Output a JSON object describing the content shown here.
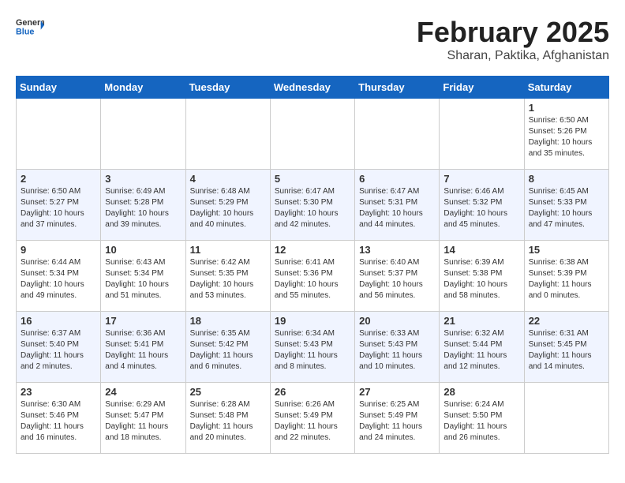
{
  "header": {
    "logo_general": "General",
    "logo_blue": "Blue",
    "month_year": "February 2025",
    "location": "Sharan, Paktika, Afghanistan"
  },
  "weekdays": [
    "Sunday",
    "Monday",
    "Tuesday",
    "Wednesday",
    "Thursday",
    "Friday",
    "Saturday"
  ],
  "weeks": [
    [
      {
        "day": "",
        "content": ""
      },
      {
        "day": "",
        "content": ""
      },
      {
        "day": "",
        "content": ""
      },
      {
        "day": "",
        "content": ""
      },
      {
        "day": "",
        "content": ""
      },
      {
        "day": "",
        "content": ""
      },
      {
        "day": "1",
        "content": "Sunrise: 6:50 AM\nSunset: 5:26 PM\nDaylight: 10 hours and 35 minutes."
      }
    ],
    [
      {
        "day": "2",
        "content": "Sunrise: 6:50 AM\nSunset: 5:27 PM\nDaylight: 10 hours and 37 minutes."
      },
      {
        "day": "3",
        "content": "Sunrise: 6:49 AM\nSunset: 5:28 PM\nDaylight: 10 hours and 39 minutes."
      },
      {
        "day": "4",
        "content": "Sunrise: 6:48 AM\nSunset: 5:29 PM\nDaylight: 10 hours and 40 minutes."
      },
      {
        "day": "5",
        "content": "Sunrise: 6:47 AM\nSunset: 5:30 PM\nDaylight: 10 hours and 42 minutes."
      },
      {
        "day": "6",
        "content": "Sunrise: 6:47 AM\nSunset: 5:31 PM\nDaylight: 10 hours and 44 minutes."
      },
      {
        "day": "7",
        "content": "Sunrise: 6:46 AM\nSunset: 5:32 PM\nDaylight: 10 hours and 45 minutes."
      },
      {
        "day": "8",
        "content": "Sunrise: 6:45 AM\nSunset: 5:33 PM\nDaylight: 10 hours and 47 minutes."
      }
    ],
    [
      {
        "day": "9",
        "content": "Sunrise: 6:44 AM\nSunset: 5:34 PM\nDaylight: 10 hours and 49 minutes."
      },
      {
        "day": "10",
        "content": "Sunrise: 6:43 AM\nSunset: 5:34 PM\nDaylight: 10 hours and 51 minutes."
      },
      {
        "day": "11",
        "content": "Sunrise: 6:42 AM\nSunset: 5:35 PM\nDaylight: 10 hours and 53 minutes."
      },
      {
        "day": "12",
        "content": "Sunrise: 6:41 AM\nSunset: 5:36 PM\nDaylight: 10 hours and 55 minutes."
      },
      {
        "day": "13",
        "content": "Sunrise: 6:40 AM\nSunset: 5:37 PM\nDaylight: 10 hours and 56 minutes."
      },
      {
        "day": "14",
        "content": "Sunrise: 6:39 AM\nSunset: 5:38 PM\nDaylight: 10 hours and 58 minutes."
      },
      {
        "day": "15",
        "content": "Sunrise: 6:38 AM\nSunset: 5:39 PM\nDaylight: 11 hours and 0 minutes."
      }
    ],
    [
      {
        "day": "16",
        "content": "Sunrise: 6:37 AM\nSunset: 5:40 PM\nDaylight: 11 hours and 2 minutes."
      },
      {
        "day": "17",
        "content": "Sunrise: 6:36 AM\nSunset: 5:41 PM\nDaylight: 11 hours and 4 minutes."
      },
      {
        "day": "18",
        "content": "Sunrise: 6:35 AM\nSunset: 5:42 PM\nDaylight: 11 hours and 6 minutes."
      },
      {
        "day": "19",
        "content": "Sunrise: 6:34 AM\nSunset: 5:43 PM\nDaylight: 11 hours and 8 minutes."
      },
      {
        "day": "20",
        "content": "Sunrise: 6:33 AM\nSunset: 5:43 PM\nDaylight: 11 hours and 10 minutes."
      },
      {
        "day": "21",
        "content": "Sunrise: 6:32 AM\nSunset: 5:44 PM\nDaylight: 11 hours and 12 minutes."
      },
      {
        "day": "22",
        "content": "Sunrise: 6:31 AM\nSunset: 5:45 PM\nDaylight: 11 hours and 14 minutes."
      }
    ],
    [
      {
        "day": "23",
        "content": "Sunrise: 6:30 AM\nSunset: 5:46 PM\nDaylight: 11 hours and 16 minutes."
      },
      {
        "day": "24",
        "content": "Sunrise: 6:29 AM\nSunset: 5:47 PM\nDaylight: 11 hours and 18 minutes."
      },
      {
        "day": "25",
        "content": "Sunrise: 6:28 AM\nSunset: 5:48 PM\nDaylight: 11 hours and 20 minutes."
      },
      {
        "day": "26",
        "content": "Sunrise: 6:26 AM\nSunset: 5:49 PM\nDaylight: 11 hours and 22 minutes."
      },
      {
        "day": "27",
        "content": "Sunrise: 6:25 AM\nSunset: 5:49 PM\nDaylight: 11 hours and 24 minutes."
      },
      {
        "day": "28",
        "content": "Sunrise: 6:24 AM\nSunset: 5:50 PM\nDaylight: 11 hours and 26 minutes."
      },
      {
        "day": "",
        "content": ""
      }
    ]
  ]
}
